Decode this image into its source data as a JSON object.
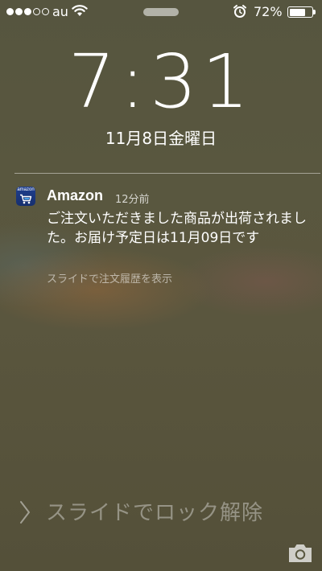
{
  "status_bar": {
    "signal_bars_filled": 3,
    "signal_bars_total": 5,
    "carrier": "au",
    "wifi_icon": "wifi-icon",
    "alarm_icon": "alarm-clock-icon",
    "battery_percent_text": "72%",
    "battery_level": 0.72
  },
  "lock_screen": {
    "time": "7:31",
    "date": "11月8日金曜日"
  },
  "notification": {
    "app_icon": "amazon-cart-icon",
    "app_icon_brand": "amazon",
    "app_name": "Amazon",
    "time_ago": "12分前",
    "message": "ご注文いただきました商品が出荷されました。お届け予定日は11月09日です",
    "action_hint": "スライドで注文履歴を表示"
  },
  "bottom": {
    "chevron_icon": "chevron-right-icon",
    "slide_to_unlock": "スライドでロック解除",
    "camera_icon": "camera-icon"
  },
  "colors": {
    "background": "#57553f",
    "text": "#ffffff",
    "app_icon_blue": "#1f3f8f"
  }
}
